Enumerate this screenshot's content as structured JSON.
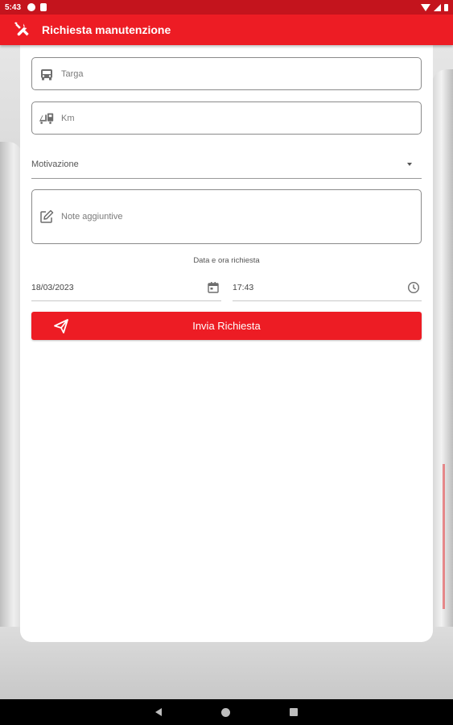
{
  "status_bar": {
    "time": "5:43",
    "icons": [
      "notification-icon",
      "notification-icon",
      "wifi-icon",
      "signal-icon",
      "battery-icon"
    ]
  },
  "app_bar": {
    "title": "Richiesta manutenzione",
    "icon": "tools-icon",
    "color": "#ed1c24"
  },
  "form": {
    "targa": {
      "placeholder": "Targa",
      "icon": "car-icon"
    },
    "km": {
      "placeholder": "Km",
      "icon": "odometer-icon"
    },
    "motivazione": {
      "label": "Motivazione",
      "icon": "dropdown-caret-icon"
    },
    "note": {
      "placeholder": "Note aggiuntive",
      "icon": "edit-icon"
    },
    "datetime_label": "Data e ora richiesta",
    "date": {
      "value": "18/03/2023",
      "icon": "calendar-icon"
    },
    "time": {
      "value": "17:43",
      "icon": "clock-icon"
    },
    "submit": {
      "label": "Invia Richiesta",
      "icon": "send-icon"
    }
  },
  "nav_bar": {
    "buttons": [
      "back-icon",
      "home-icon",
      "recents-icon"
    ]
  }
}
